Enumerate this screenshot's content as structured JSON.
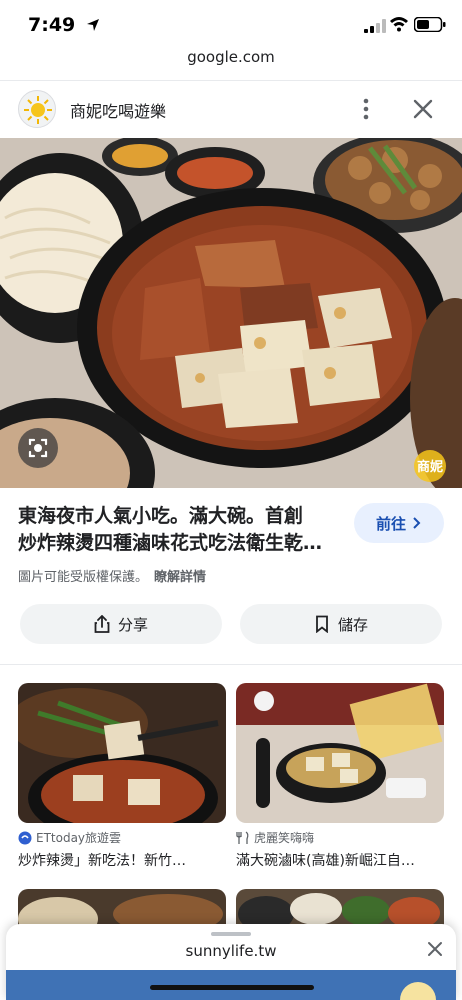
{
  "status_bar": {
    "time": "7:49"
  },
  "browser": {
    "url": "google.com"
  },
  "site": {
    "name": "商妮吃喝遊樂"
  },
  "result": {
    "title_line1": "東海夜市人氣小吃。滿大碗。首創",
    "title_line2": "炒炸辣燙四種滷味花式吃法衛生乾…",
    "visit_label": "前往",
    "copyright_text": "圖片可能受版權保護。",
    "learn_more": "瞭解詳情",
    "share_label": "分享",
    "save_label": "儲存",
    "watermark_text": "商妮"
  },
  "related": [
    {
      "source": "ETtoday旅遊雲",
      "title": "炒炸辣燙」新吃法！新竹…"
    },
    {
      "source": "虎麗笑嗨嗨",
      "title": "滿大碗滷味(高雄)新崛江自…"
    },
    {
      "source": "",
      "title": ""
    },
    {
      "source": "",
      "title": ""
    }
  ],
  "sheet": {
    "domain": "sunnylife.tw"
  },
  "colors": {
    "accent": "#1a4fb1",
    "visit_bg": "#e8f0fe",
    "chip_bg": "#f1f3f4"
  },
  "icons": [
    "location-arrow-icon",
    "signal-icon",
    "wifi-icon",
    "battery-icon",
    "sun-logo-icon",
    "more-vertical-icon",
    "close-icon",
    "lens-icon",
    "chevron-right-icon",
    "share-icon",
    "bookmark-icon",
    "fork-knife-icon"
  ]
}
